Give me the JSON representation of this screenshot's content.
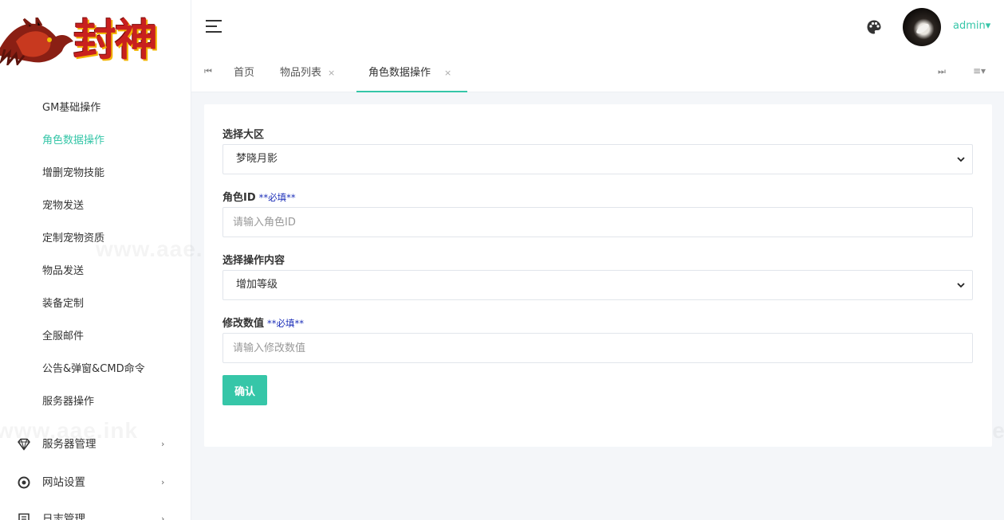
{
  "logo": {
    "text": "封神"
  },
  "sidebar": {
    "sub_items": [
      {
        "label": "GM基础操作"
      },
      {
        "label": "角色数据操作"
      },
      {
        "label": "增删宠物技能"
      },
      {
        "label": "宠物发送"
      },
      {
        "label": "定制宠物资质"
      },
      {
        "label": "物品发送"
      },
      {
        "label": "装备定制"
      },
      {
        "label": "全服邮件"
      },
      {
        "label": "公告&弹窗&CMD命令"
      },
      {
        "label": "服务器操作"
      }
    ],
    "active_sub_item": "角色数据操作",
    "main_items": [
      {
        "label": "服务器管理",
        "icon": "diamond-icon",
        "arrow": "›"
      },
      {
        "label": "网站设置",
        "icon": "settings-circle-icon",
        "arrow": "›"
      },
      {
        "label": "日志管理",
        "icon": "document-icon",
        "arrow": "›"
      }
    ]
  },
  "header": {
    "menu_icon": "hamburger-icon",
    "theme_icon": "palette-icon",
    "user_name": "admin▾"
  },
  "tabs": {
    "prev_icon": "⏮",
    "next_icon": "⏭",
    "menu_icon": "≡▾",
    "items": [
      {
        "label": "首页",
        "closable": false
      },
      {
        "label": "物品列表",
        "closable": true
      },
      {
        "label": "角色数据操作",
        "closable": true,
        "active": true
      }
    ],
    "close_glyph": "×"
  },
  "form": {
    "region": {
      "label": "选择大区",
      "value": "梦晓月影"
    },
    "role_id": {
      "label": "角色ID",
      "required": "**必填**",
      "placeholder": "请输入角色ID"
    },
    "operation": {
      "label": "选择操作内容",
      "value": "增加等级"
    },
    "modify_value": {
      "label": "修改数值",
      "required": "**必填**",
      "placeholder": "请输入修改数值"
    },
    "submit_label": "确认"
  },
  "watermark": {
    "text": "www.aae.ink"
  },
  "colors": {
    "accent": "#36c6a8",
    "required": "#1a2db8",
    "background": "#f4f6f9"
  }
}
